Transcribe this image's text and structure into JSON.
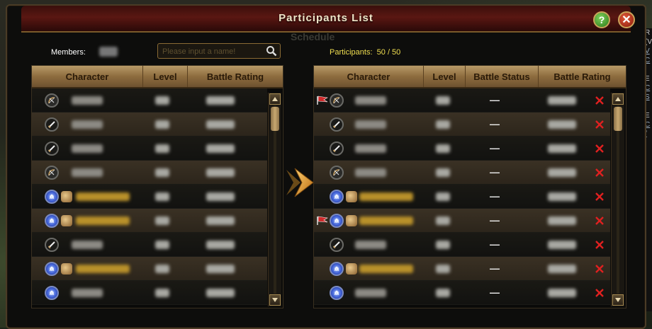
{
  "window": {
    "title": "Participants List",
    "ghost_tab": "Schedule"
  },
  "controls": {
    "help": "?",
    "close": "✕"
  },
  "members": {
    "label": "Members:"
  },
  "search": {
    "placeholder": "Please input a name!"
  },
  "participants": {
    "label": "Participants:",
    "count": "50 / 50"
  },
  "left_table": {
    "headers": [
      "Character",
      "Level",
      "Battle Rating"
    ],
    "rows": [
      {
        "icon": "bow-icon",
        "noble": false
      },
      {
        "icon": "sword-icon",
        "noble": false
      },
      {
        "icon": "sword-icon",
        "noble": false
      },
      {
        "icon": "bow-icon",
        "noble": false
      },
      {
        "icon": "magic-orb-icon",
        "noble": true
      },
      {
        "icon": "magic-orb-icon",
        "noble": true
      },
      {
        "icon": "sword-icon",
        "noble": false
      },
      {
        "icon": "magic-orb-icon",
        "noble": true
      },
      {
        "icon": "magic-orb-icon",
        "noble": false
      }
    ]
  },
  "right_table": {
    "headers": [
      "Character",
      "Level",
      "Battle Status",
      "Battle Rating"
    ],
    "rows": [
      {
        "icon": "bow-icon",
        "noble": false,
        "flag": true,
        "status": "—"
      },
      {
        "icon": "sword-icon",
        "noble": false,
        "flag": false,
        "status": "—"
      },
      {
        "icon": "sword-icon",
        "noble": false,
        "flag": false,
        "status": "—"
      },
      {
        "icon": "bow-icon",
        "noble": false,
        "flag": false,
        "status": "—"
      },
      {
        "icon": "magic-orb-icon",
        "noble": true,
        "flag": false,
        "status": "—"
      },
      {
        "icon": "magic-orb-icon",
        "noble": true,
        "flag": true,
        "status": "—"
      },
      {
        "icon": "sword-icon",
        "noble": false,
        "flag": false,
        "status": "—"
      },
      {
        "icon": "magic-orb-icon",
        "noble": true,
        "flag": false,
        "status": "—"
      },
      {
        "icon": "magic-orb-icon",
        "noble": false,
        "flag": false,
        "status": "—"
      }
    ]
  },
  "colors": {
    "accent": "#f0de50",
    "remove": "#e02020",
    "header": "#a8885a"
  }
}
